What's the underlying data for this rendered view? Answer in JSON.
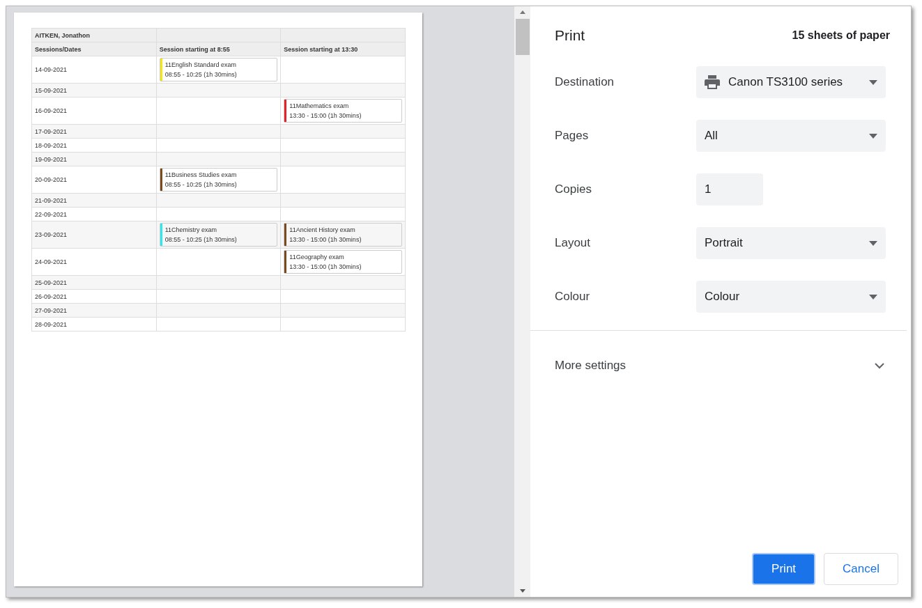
{
  "preview": {
    "student": "AITKEN, Jonathon",
    "columns": [
      "Sessions/Dates",
      "Session starting at 8:55",
      "Session starting at 13:30"
    ],
    "rows": [
      {
        "date": "14-09-2021",
        "early": {
          "title": "11English Standard exam",
          "time": "08:55 - 10:25 (1h 30mins)",
          "color": "#f5e615"
        }
      },
      {
        "date": "15-09-2021"
      },
      {
        "date": "16-09-2021",
        "late": {
          "title": "11Mathematics exam",
          "time": "13:30 - 15:00 (1h 30mins)",
          "color": "#e8202a"
        }
      },
      {
        "date": "17-09-2021"
      },
      {
        "date": "18-09-2021"
      },
      {
        "date": "19-09-2021"
      },
      {
        "date": "20-09-2021",
        "early": {
          "title": "11Business Studies exam",
          "time": "08:55 - 10:25 (1h 30mins)",
          "color": "#7b4a1e"
        }
      },
      {
        "date": "21-09-2021"
      },
      {
        "date": "22-09-2021"
      },
      {
        "date": "23-09-2021",
        "early": {
          "title": "11Chemistry exam",
          "time": "08:55 - 10:25 (1h 30mins)",
          "color": "#2ee8ee"
        },
        "late": {
          "title": "11Ancient History exam",
          "time": "13:30 - 15:00 (1h 30mins)",
          "color": "#7b4a1e"
        }
      },
      {
        "date": "24-09-2021",
        "late": {
          "title": "11Geography exam",
          "time": "13:30 - 15:00 (1h 30mins)",
          "color": "#7b4a1e"
        }
      },
      {
        "date": "25-09-2021"
      },
      {
        "date": "26-09-2021"
      },
      {
        "date": "27-09-2021"
      },
      {
        "date": "28-09-2021"
      }
    ]
  },
  "panel": {
    "title": "Print",
    "sheets": "15 sheets of paper",
    "settings": [
      {
        "label": "Destination",
        "kind": "printer",
        "value": "Canon TS3100 series"
      },
      {
        "label": "Pages",
        "kind": "select",
        "value": "All"
      },
      {
        "label": "Copies",
        "kind": "input",
        "value": "1"
      },
      {
        "label": "Layout",
        "kind": "select",
        "value": "Portrait"
      },
      {
        "label": "Colour",
        "kind": "select",
        "value": "Colour"
      }
    ],
    "more_settings": {
      "label": "More settings",
      "expanded": false
    },
    "buttons": [
      {
        "label": "Print",
        "kind": "primary"
      },
      {
        "label": "Cancel",
        "kind": "secondary"
      }
    ]
  }
}
